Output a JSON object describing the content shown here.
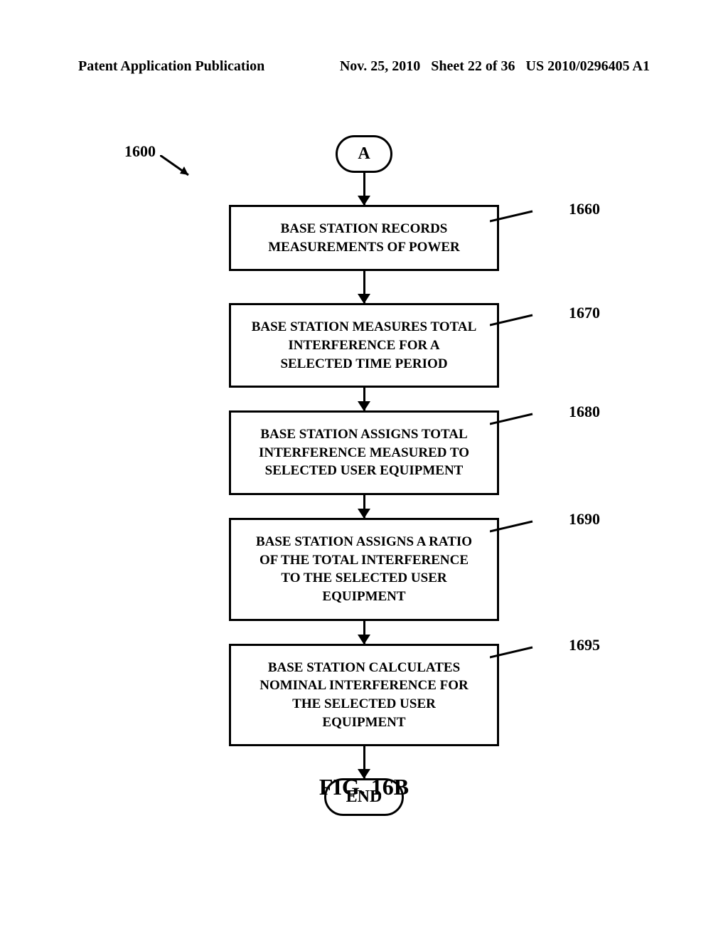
{
  "header": {
    "left": "Patent Application Publication",
    "date": "Nov. 25, 2010",
    "sheet": "Sheet 22 of 36",
    "pub_num": "US 2010/0296405 A1"
  },
  "flowchart": {
    "ref_num": "1600",
    "start": "A",
    "boxes": [
      {
        "text": "BASE STATION RECORDS MEASUREMENTS OF POWER",
        "ref": "1660"
      },
      {
        "text": "BASE STATION MEASURES TOTAL INTERFERENCE FOR A SELECTED TIME PERIOD",
        "ref": "1670"
      },
      {
        "text": "BASE STATION ASSIGNS TOTAL INTERFERENCE MEASURED TO SELECTED USER EQUIPMENT",
        "ref": "1680"
      },
      {
        "text": "BASE STATION ASSIGNS A RATIO OF THE TOTAL INTERFERENCE TO THE SELECTED USER EQUIPMENT",
        "ref": "1690"
      },
      {
        "text": "BASE STATION CALCULATES NOMINAL INTERFERENCE FOR THE SELECTED USER EQUIPMENT",
        "ref": "1695"
      }
    ],
    "end": "END"
  },
  "figure_title": "FIG. 16B"
}
